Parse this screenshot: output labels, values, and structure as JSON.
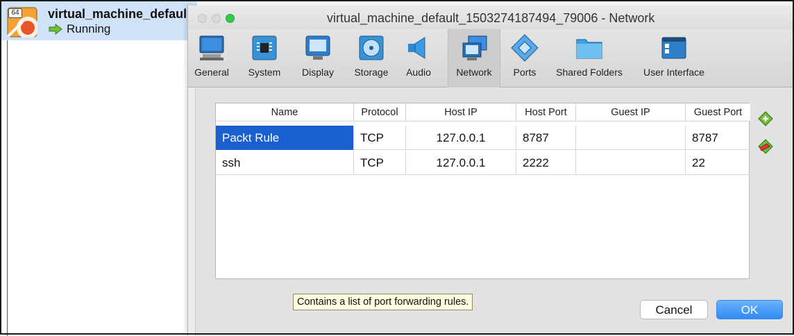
{
  "vm_list": {
    "arch_badge": "64",
    "vm_name": "virtual_machine_defaul",
    "vm_state": "Running"
  },
  "dialog": {
    "title": "virtual_machine_default_1503274187494_79006 - Network",
    "toolbar": [
      {
        "label": "General",
        "icon": "general-icon"
      },
      {
        "label": "System",
        "icon": "system-icon"
      },
      {
        "label": "Display",
        "icon": "display-icon"
      },
      {
        "label": "Storage",
        "icon": "storage-icon"
      },
      {
        "label": "Audio",
        "icon": "audio-icon"
      },
      {
        "label": "Network",
        "icon": "network-icon",
        "selected": true
      },
      {
        "label": "Ports",
        "icon": "ports-icon"
      },
      {
        "label": "Shared Folders",
        "icon": "shared-folders-icon"
      },
      {
        "label": "User Interface",
        "icon": "user-interface-icon"
      }
    ]
  },
  "port_forwarding": {
    "columns": [
      "Name",
      "Protocol",
      "Host IP",
      "Host Port",
      "Guest IP",
      "Guest Port"
    ],
    "rows": [
      {
        "name": "Packt Rule",
        "protocol": "TCP",
        "host_ip": "127.0.0.1",
        "host_port": "8787",
        "guest_ip": "",
        "guest_port": "8787",
        "selected": true
      },
      {
        "name": "ssh",
        "protocol": "TCP",
        "host_ip": "127.0.0.1",
        "host_port": "2222",
        "guest_ip": "",
        "guest_port": "22"
      }
    ],
    "tooltip": "Contains a list of port forwarding rules.",
    "add_rule_icon": "add-rule-icon",
    "remove_rule_icon": "remove-rule-icon"
  },
  "buttons": {
    "cancel": "Cancel",
    "ok": "OK"
  },
  "colors": {
    "selection": "#1a5fd0",
    "ok_button": "#2f8af3",
    "vm_item_highlight": "#cfe2f8",
    "tooltip_bg": "#ffffe0"
  }
}
